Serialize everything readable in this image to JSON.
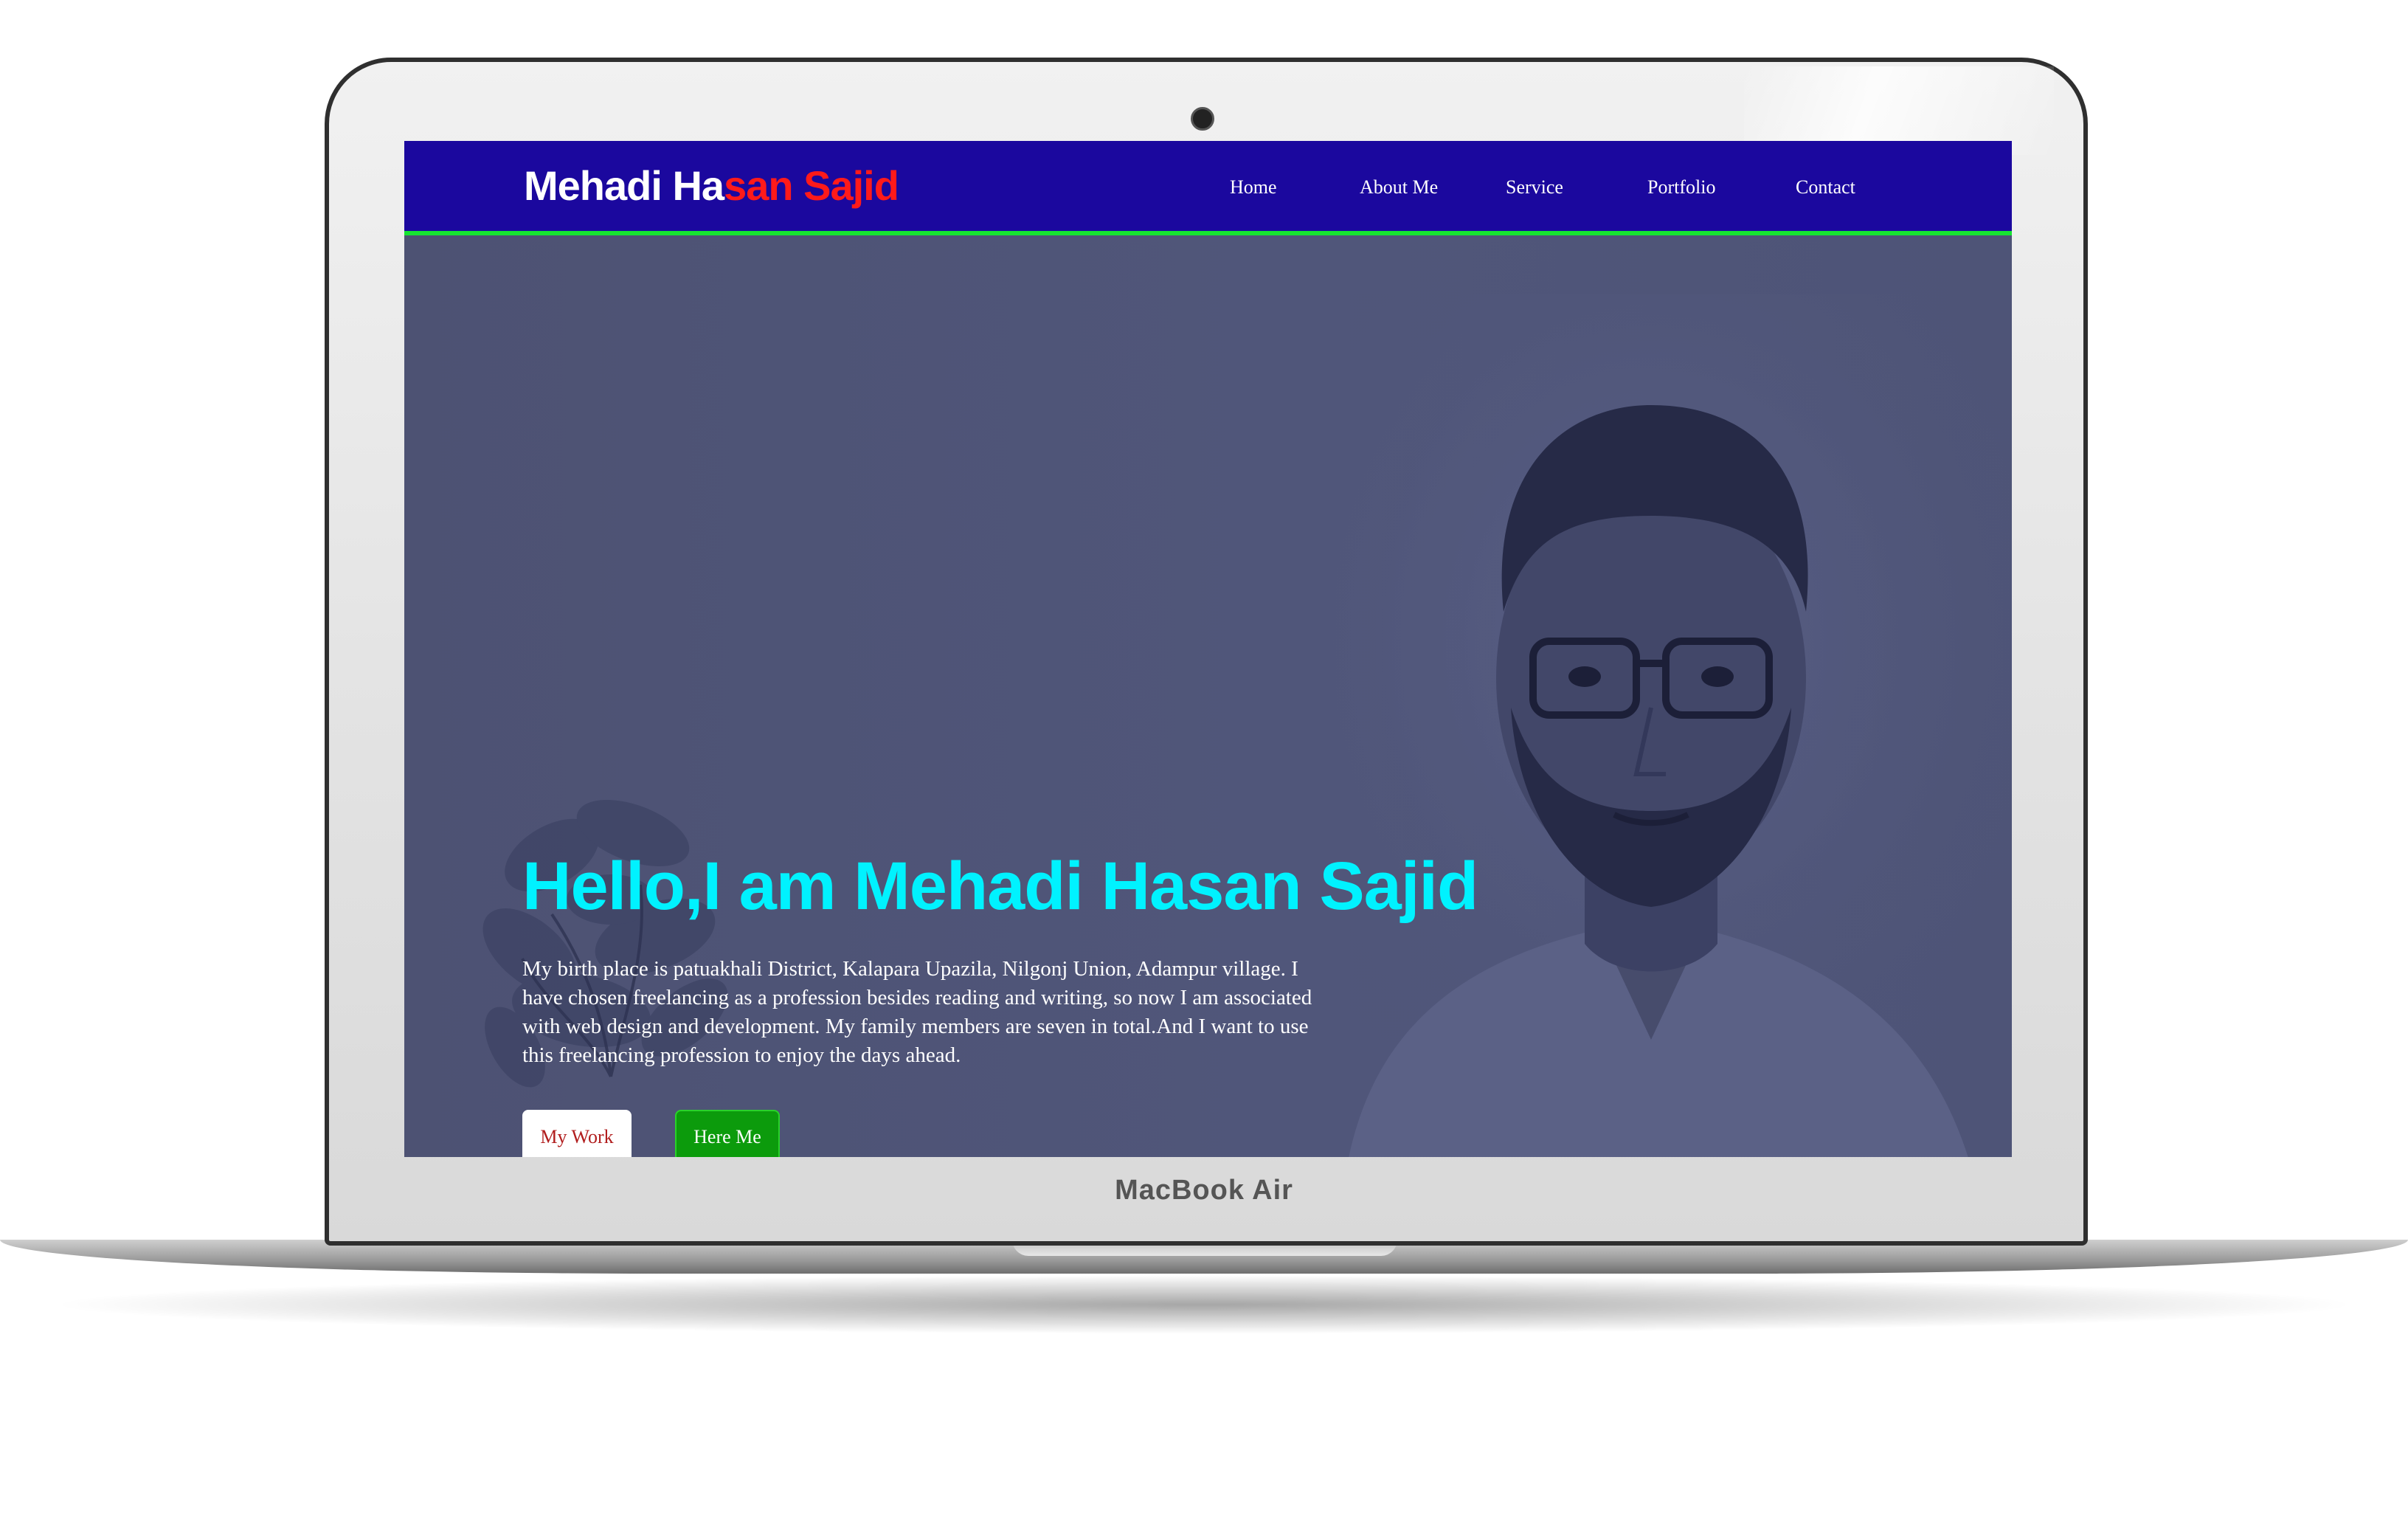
{
  "device": {
    "brand": "MacBook Air"
  },
  "site": {
    "logo_part1": "Mehadi Ha",
    "logo_part2": "san Sajid",
    "nav": [
      "Home",
      "About Me",
      "Service",
      "Portfolio",
      "Contact"
    ],
    "hero": {
      "title": "Hello,I am Mehadi Hasan Sajid",
      "description": "My birth place is patuakhali District, Kalapara Upazila, Nilgonj Union, Adampur village. I have chosen freelancing as a profession besides reading and writing, so now I am associated with web design and development. My family members are seven in total.And I want to use this freelancing profession to enjoy the days ahead.",
      "button_primary": "My Work",
      "button_secondary": "Here Me"
    }
  },
  "colors": {
    "nav_bg": "#1b089e",
    "nav_border": "#16e431",
    "title": "#00f2ff",
    "logo_accent": "#ff1a1a",
    "button_green": "#0c9b0c"
  }
}
